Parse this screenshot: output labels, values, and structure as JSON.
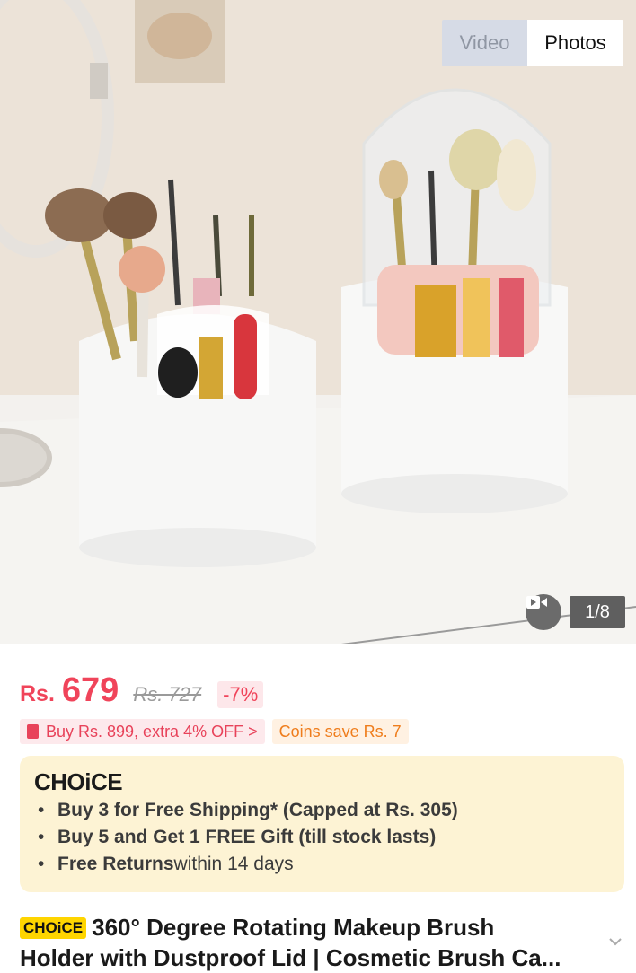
{
  "media": {
    "video_label": "Video",
    "photos_label": "Photos",
    "counter": "1/8"
  },
  "price": {
    "currency": "Rs.",
    "value": "679",
    "original": "Rs. 727",
    "discount": "-7%"
  },
  "promos": {
    "voucher": "Buy Rs. 899, extra 4% OFF >",
    "coins": "Coins save Rs. 7"
  },
  "choice": {
    "logo": "CHOiCE",
    "items": [
      {
        "bold": "Buy 3 for  Free Shipping* (Capped at Rs. 305)",
        "rest": ""
      },
      {
        "bold": "Buy 5 and Get 1 FREE Gift (till stock lasts)",
        "rest": ""
      },
      {
        "bold": "Free Returns",
        "rest": " within 14 days"
      }
    ]
  },
  "product": {
    "badge": "CHOiCE",
    "title_line1": "360° Degree Rotating Makeup Brush",
    "title_line2": "Holder with Dustproof Lid | Cosmetic Brush Ca..."
  },
  "colors": {
    "accent": "#f0445a",
    "coins": "#ef7d1c",
    "choice_bg": "#fdf3d4",
    "badge": "#ffd500"
  }
}
